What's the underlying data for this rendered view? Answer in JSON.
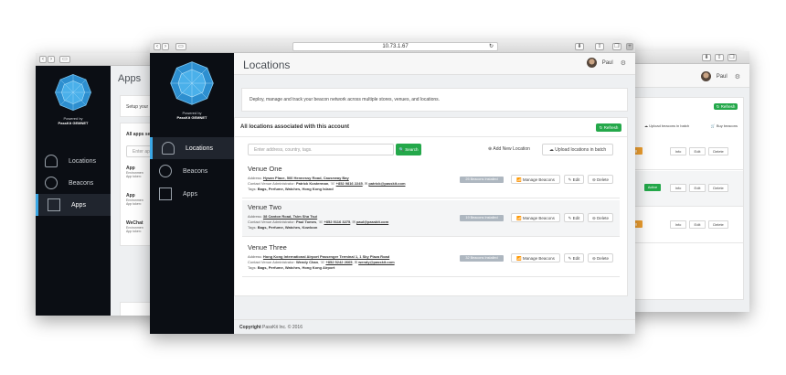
{
  "main_window": {
    "url": "10.73.1.67",
    "sidebar": {
      "powered_by": "Powered by",
      "brand": "PassKit GEMNET",
      "items": [
        {
          "label": "Locations",
          "icon": "map-pin-icon",
          "active": true
        },
        {
          "label": "Beacons",
          "icon": "beacon-icon",
          "active": false
        },
        {
          "label": "Apps",
          "icon": "apps-icon",
          "active": false
        }
      ]
    },
    "header": {
      "title": "Locations",
      "user": "Paul"
    },
    "intro": "Deploy, manage and track your beacon network across multiple stores, venues, and locations.",
    "section_title": "All locations associated with this account",
    "refresh_label": "Refresh",
    "search": {
      "placeholder": "Enter address, country, tags.",
      "button": "Search"
    },
    "add_label": "Add New Location",
    "upload_label": "Upload locations in batch",
    "venues": [
      {
        "name": "Venue One",
        "address_label": "Address:",
        "address": "Hysan Place, 500 Hennessy Road, Causeway Bay",
        "contact_label": "Contact Venue Administrator:",
        "contact_name": "Patrick Kosterman",
        "phone": "+852 9816 2245",
        "email": "patrick@passkit.com",
        "tags_label": "Tags:",
        "tags": "Bags, Perfume, Watches, Hong Kong Island",
        "beacons": "25 Beacons Installed"
      },
      {
        "name": "Venue Two",
        "address_label": "Address:",
        "address": "38 Canton Road, Tsim Sha Tsui",
        "contact_label": "Contact Venue Administrator:",
        "contact_name": "Paul Tomes",
        "phone": "+852 9116 3275",
        "email": "paul@passkit.com",
        "tags_label": "Tags:",
        "tags": "Bags, Perfume, Watches, Kowloon",
        "beacons": "19 Beacons Installed"
      },
      {
        "name": "Venue Three",
        "address_label": "Address:",
        "address": "Hong Kong International Airport Passenger Terminal 1, 1 Sky Plaza Road",
        "contact_label": "Contact Venue Administrator:",
        "contact_name": "Wendy Chan",
        "phone": "+852 5242 2665",
        "email": "wendy@passkit.com",
        "tags_label": "Tags:",
        "tags": "Bags, Perfume, Watches, Hong Kong Airport",
        "beacons": "32 Beacons Installed"
      }
    ],
    "row_actions": {
      "manage": "Manage Beacons",
      "edit": "Edit",
      "delete": "Delete"
    },
    "footer": {
      "copyright": "Copyright",
      "text": "PassKit Inc. © 2016"
    }
  },
  "left_window": {
    "title": "Apps",
    "setup_text": "Setup your",
    "apps_section": "All apps se",
    "search_placeholder": "Enter ap",
    "apps": [
      {
        "name": "App",
        "line1": "Environmen",
        "line2": "App token:"
      },
      {
        "name": "App",
        "line1": "Environmen",
        "line2": "App token:"
      },
      {
        "name": "WeChat",
        "line1": "Environmen",
        "line2": "App token:"
      }
    ],
    "sidebar_items": [
      {
        "label": "Locations",
        "icon": "map-pin-icon"
      },
      {
        "label": "Beacons",
        "icon": "beacon-icon"
      },
      {
        "label": "Apps",
        "icon": "apps-icon"
      }
    ],
    "powered_by": "Powered by",
    "brand": "PassKit GEMNET"
  },
  "right_window": {
    "user": "Paul",
    "refresh_label": "Refresh",
    "upload_label": "Upload beacons in batch",
    "buy_label": "Buy beacons",
    "rows": [
      {
        "status": "Pending",
        "status_color": "#f0a030"
      },
      {
        "status": "Active",
        "status_color": "#24a84a"
      },
      {
        "status": "Pending",
        "status_color": "#f0a030"
      }
    ],
    "actions": {
      "info": "Info",
      "edit": "Edit",
      "delete": "Delete"
    }
  }
}
